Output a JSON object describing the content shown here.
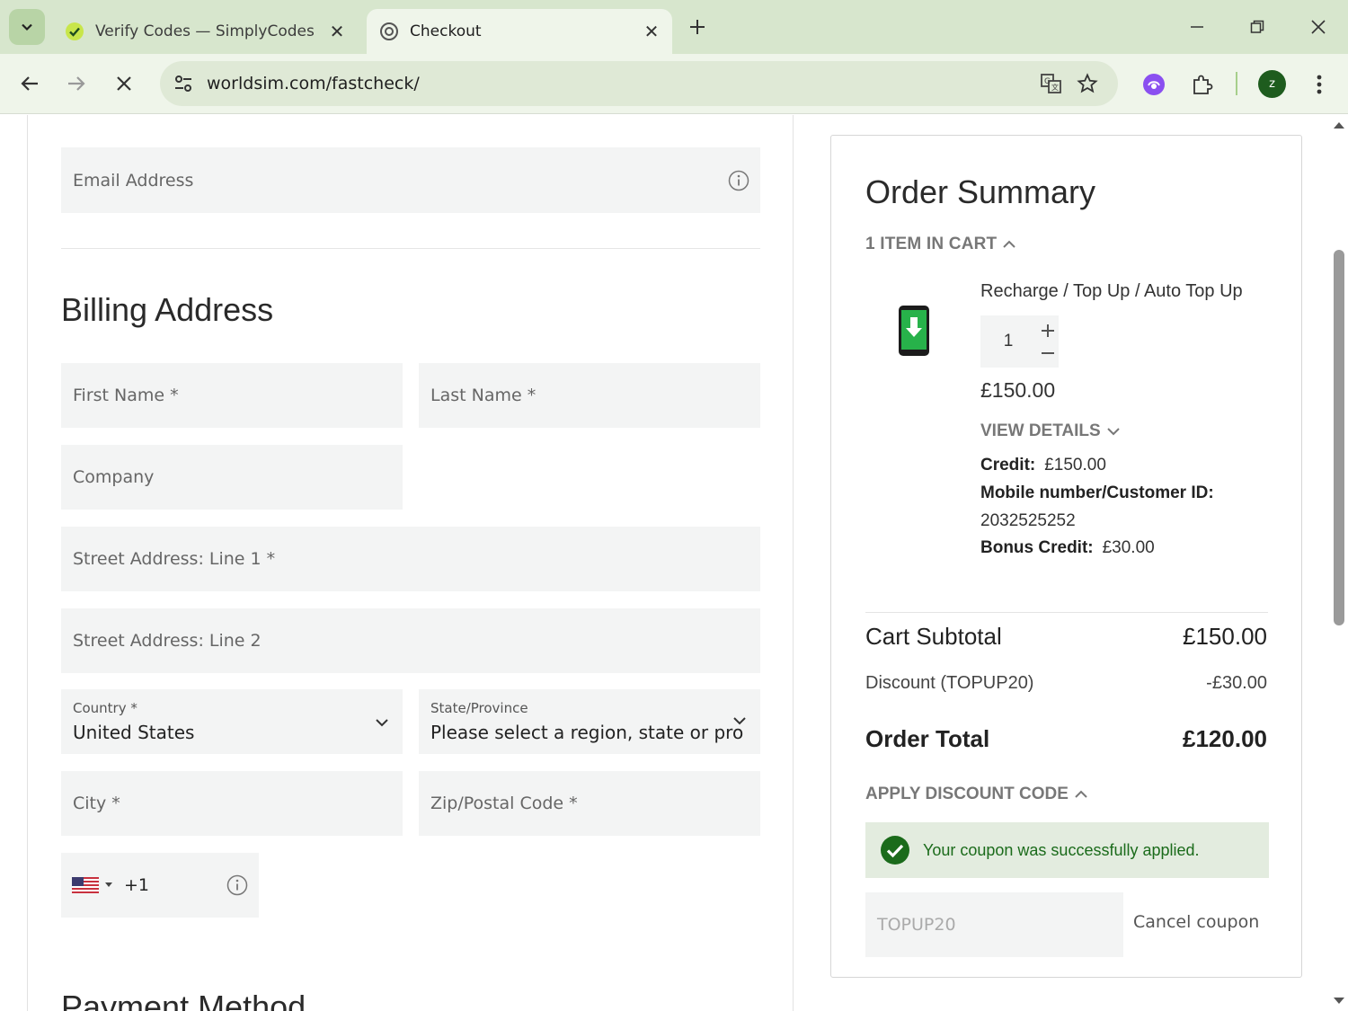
{
  "browser": {
    "tabs": [
      {
        "title": "Verify Codes — SimplyCodes",
        "active": false
      },
      {
        "title": "Checkout",
        "active": true
      }
    ],
    "url": "worldsim.com/fastcheck/",
    "profile_initial": "z",
    "accent_color": "#d7e6cd"
  },
  "form": {
    "email_placeholder": "Email Address",
    "billing_title": "Billing Address",
    "first_name_placeholder": "First Name *",
    "last_name_placeholder": "Last Name *",
    "company_placeholder": "Company",
    "street1_placeholder": "Street Address: Line 1 *",
    "street2_placeholder": "Street Address: Line 2",
    "country_label": "Country *",
    "country_value": "United States",
    "state_label": "State/Province",
    "state_value": "Please select a region, state or pro",
    "city_placeholder": "City *",
    "zip_placeholder": "Zip/Postal Code *",
    "phone_code": "+1",
    "payment_title": "Payment Method"
  },
  "summary": {
    "title": "Order Summary",
    "items_toggle": "1 ITEM IN CART",
    "product": {
      "name": "Recharge / Top Up / Auto Top Up",
      "quantity": "1",
      "price": "£150.00",
      "view_details": "VIEW DETAILS",
      "credit_label": "Credit:",
      "credit_value": "£150.00",
      "mobile_label": "Mobile number/Customer ID:",
      "mobile_value": "2032525252",
      "bonus_label": "Bonus Credit:",
      "bonus_value": "£30.00"
    },
    "subtotal_label": "Cart Subtotal",
    "subtotal_value": "£150.00",
    "discount_label": "Discount (TOPUP20)",
    "discount_value": "-£30.00",
    "total_label": "Order Total",
    "total_value": "£120.00",
    "apply_toggle": "APPLY DISCOUNT CODE",
    "success_message": "Your coupon was successfully applied.",
    "coupon_value": "TOPUP20",
    "cancel_coupon": "Cancel coupon",
    "success_color": "#1b6b1b"
  }
}
